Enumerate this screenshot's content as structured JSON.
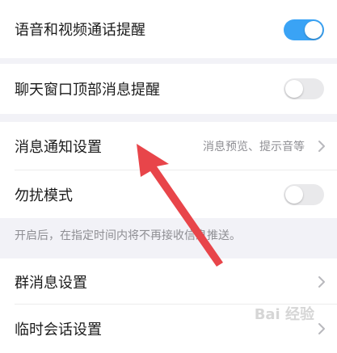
{
  "settings": {
    "voice_video_reminder": {
      "label": "语音和视频通话提醒",
      "enabled": true
    },
    "chat_top_reminder": {
      "label": "聊天窗口顶部消息提醒",
      "enabled": false
    },
    "notification_settings": {
      "label": "消息通知设置",
      "value": "消息预览、提示音等"
    },
    "dnd_mode": {
      "label": "勿扰模式",
      "enabled": false
    },
    "dnd_hint": "开启后，在指定时间内将不再接收信息推送。",
    "group_settings": {
      "label": "群消息设置"
    },
    "temp_chat_settings": {
      "label": "临时会话设置"
    }
  },
  "overlay": {
    "arrow_color": "#e8454a",
    "arrow_icon": "red-pointer-arrow",
    "watermark": "Bai 经验"
  },
  "colors": {
    "toggle_on": "#3aa3f5",
    "toggle_off": "#e9e9eb",
    "background": "#f2f2f7"
  }
}
